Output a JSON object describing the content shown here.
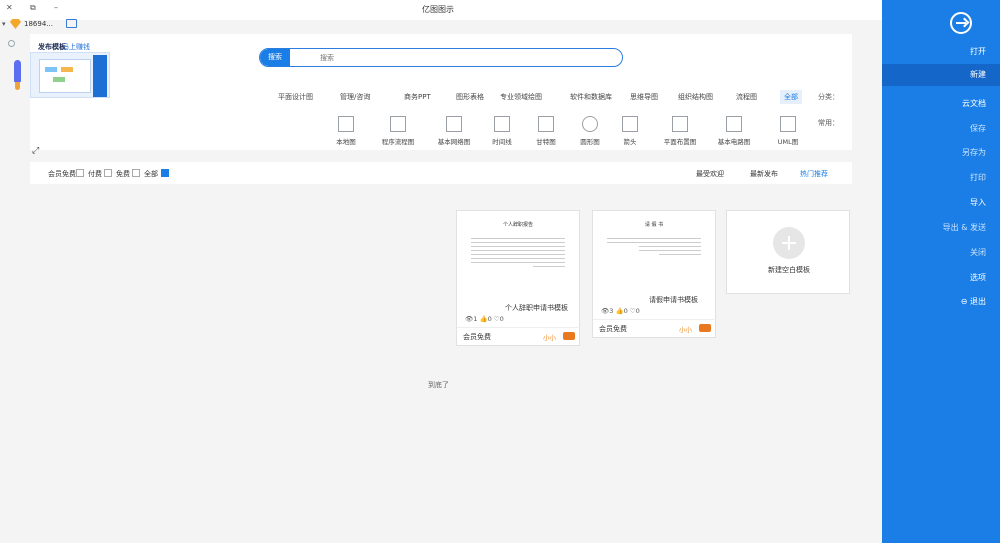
{
  "window": {
    "title": "亿图图示",
    "minimize": "–",
    "restore": "⧉",
    "close": "✕"
  },
  "user": {
    "name": "18694...",
    "dropdown": "▾"
  },
  "promo": {
    "title": "发布模板",
    "subtitle": "马上赚钱"
  },
  "search": {
    "button": "搜索",
    "placeholder": "搜索"
  },
  "categories": {
    "label": "分类：",
    "items": [
      "全部",
      "流程图",
      "组织结构图",
      "思维导图",
      "软件和数据库",
      "专业领域绘图",
      "图形表格",
      "商务PPT",
      "管理/咨询",
      "平面设计图"
    ]
  },
  "common": {
    "label": "常用：",
    "items": [
      "UML图",
      "基本电路图",
      "平面布置图",
      "箭头",
      "圆形图",
      "甘特图",
      "时间线",
      "基本网络图",
      "程序流程图",
      "本地图"
    ]
  },
  "filter": {
    "tabs": [
      "热门推荐",
      "最新发布",
      "最受欢迎"
    ],
    "options": [
      "全部",
      "免费",
      "付费",
      "会员免费"
    ]
  },
  "cards": {
    "new_label": "新建空白模板",
    "items": [
      {
        "title": "请假申请书模板",
        "views": "3",
        "likes": "0",
        "favorites": "0",
        "free": "会员免费",
        "author": "小小"
      },
      {
        "title": "个人辞职申请书模板",
        "views": "1",
        "likes": "0",
        "favorites": "0",
        "free": "会员免费",
        "author": "小小"
      }
    ],
    "thumb1_title": "请 假 书",
    "thumb2_title": "个人辞职报告"
  },
  "status": {
    "loaded": "到底了"
  },
  "sidebar": {
    "items": [
      {
        "label": "打开"
      },
      {
        "label": "新建"
      },
      {
        "label": "云文档"
      },
      {
        "label": "保存"
      },
      {
        "label": "另存为"
      },
      {
        "label": "打印"
      },
      {
        "label": "导入"
      },
      {
        "label": "导出 & 发送"
      },
      {
        "label": "关闭"
      },
      {
        "label": "选项"
      },
      {
        "label": "退出"
      }
    ]
  },
  "colors": {
    "accent": "#1a7ee6",
    "sidebar_bg": "#1a7ee6",
    "sidebar_active": "#1467c8"
  }
}
